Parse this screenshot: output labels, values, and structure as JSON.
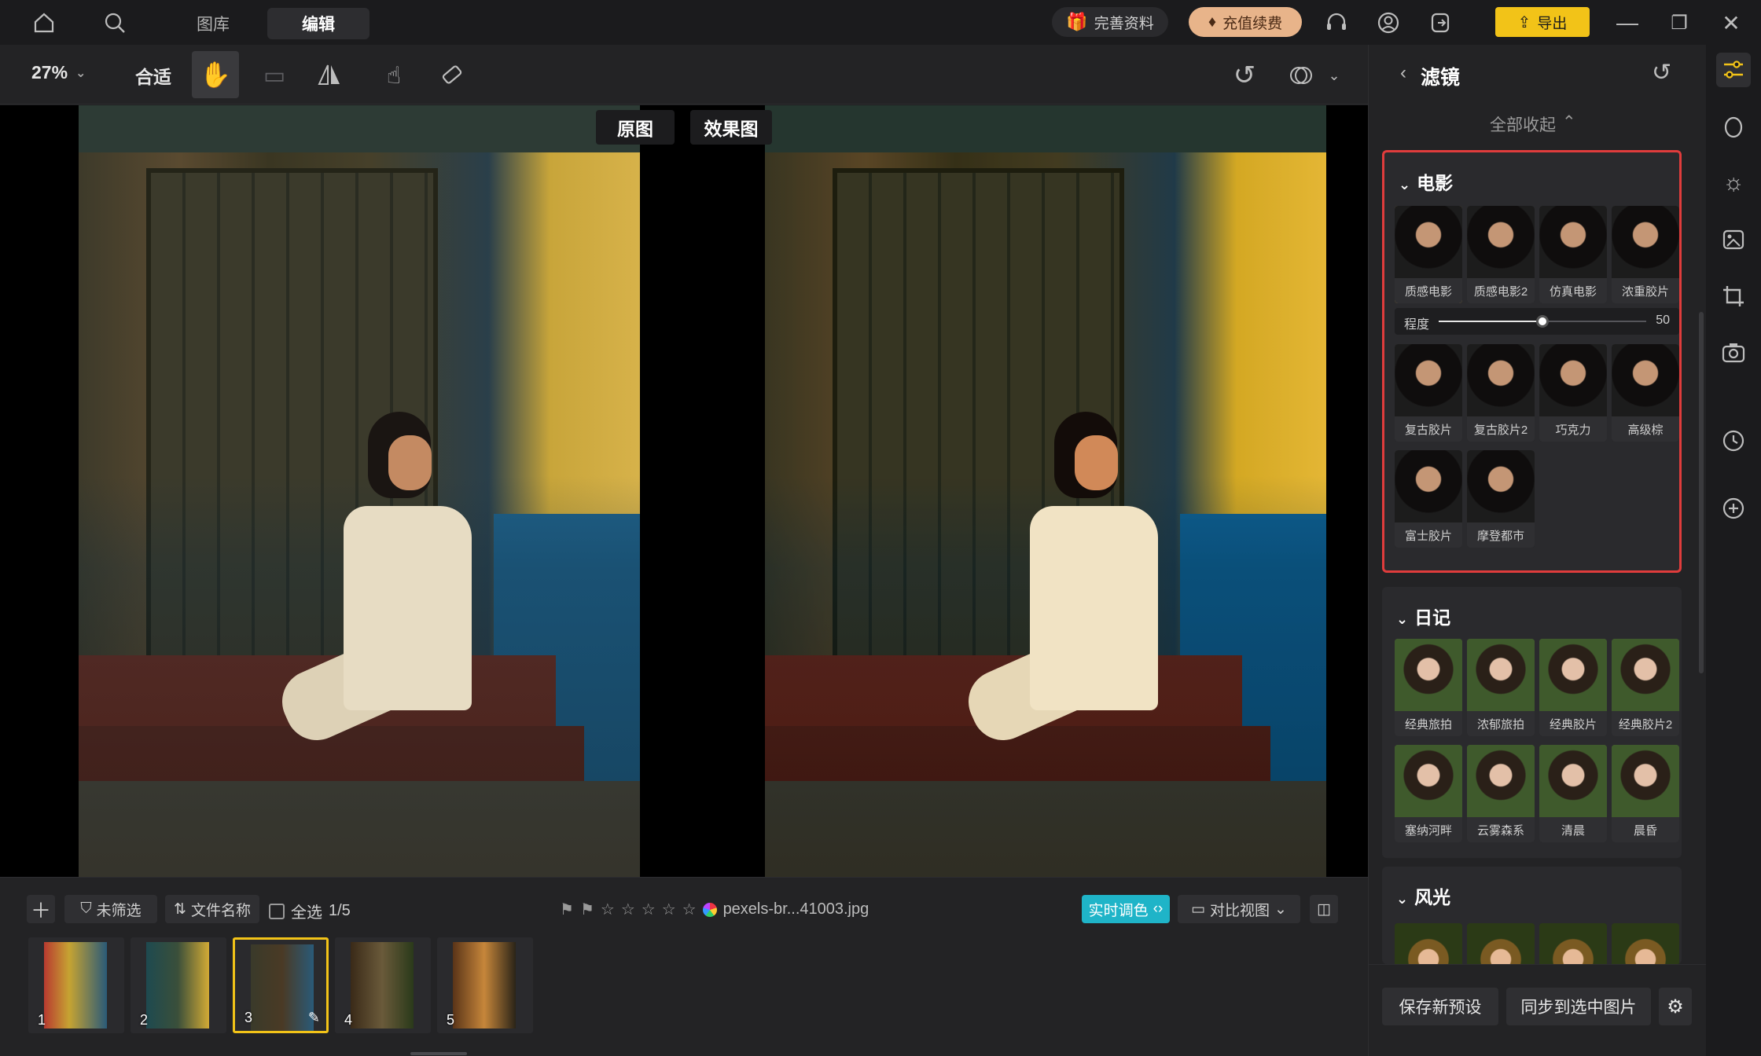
{
  "nav": {
    "tabs": [
      {
        "label": "图库"
      },
      {
        "label": "编辑"
      }
    ]
  },
  "header": {
    "profile_label": "完善资料",
    "vip_label": "充值续费",
    "export_label": "导出"
  },
  "toolbar": {
    "zoom": "27%",
    "fit_label": "合适"
  },
  "canvas": {
    "original_label": "原图",
    "effect_label": "效果图"
  },
  "bottombar": {
    "filter_label": "未筛选",
    "sort_label": "文件名称",
    "select_all_label": "全选",
    "count": "1/5",
    "filename": "pexels-br...41003.jpg",
    "realtime_label": "实时调色",
    "view_label": "对比视图"
  },
  "thumbnails": [
    {
      "num": "1"
    },
    {
      "num": "2"
    },
    {
      "num": "3"
    },
    {
      "num": "4"
    },
    {
      "num": "5"
    }
  ],
  "panel": {
    "title": "滤镜",
    "collapse_all": "全部收起",
    "sections": [
      {
        "title": "电影",
        "tiles": [
          "质感电影",
          "质感电影2",
          "仿真电影",
          "浓重胶片",
          "复古胶片",
          "复古胶片2",
          "巧克力",
          "高级棕",
          "富士胶片",
          "摩登都市"
        ],
        "slider": {
          "label": "程度",
          "value": "50",
          "level": 0.5
        }
      },
      {
        "title": "日记",
        "tiles": [
          "经典旅拍",
          "浓郁旅拍",
          "经典胶片",
          "经典胶片2",
          "塞纳河畔",
          "云雾森系",
          "清晨",
          "晨昏"
        ]
      },
      {
        "title": "风光",
        "tiles": []
      }
    ],
    "save_preset": "保存新预设",
    "sync_label": "同步到选中图片"
  },
  "colors": {
    "accent": "#f2c318",
    "highlight_border": "#e03c3c",
    "realtime_bg": "#1fb4c8"
  }
}
